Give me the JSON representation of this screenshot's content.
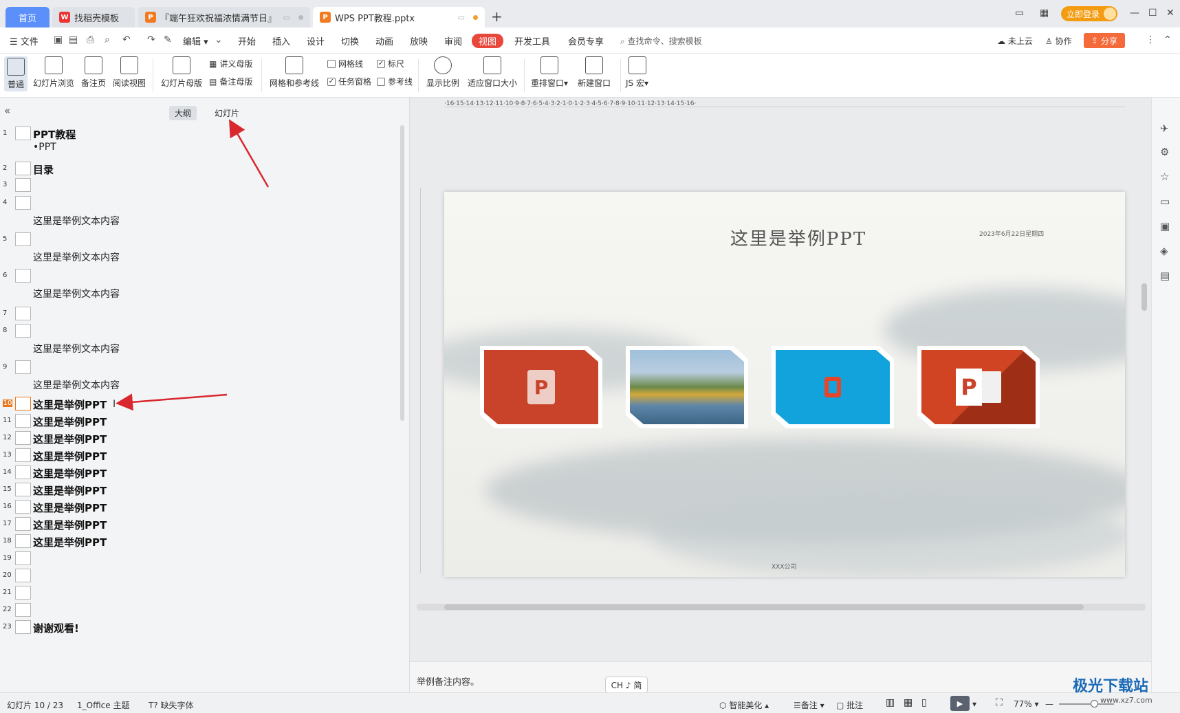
{
  "tabs": [
    {
      "label": "首页"
    },
    {
      "label": "找稻壳模板"
    },
    {
      "label": "『端午狂欢祝福浓情满节日』"
    },
    {
      "label": "WPS PPT教程.pptx"
    }
  ],
  "titlebar": {
    "login": "立即登录",
    "win_controls": [
      "—",
      "☐",
      "✕"
    ]
  },
  "menu": {
    "file": "文件",
    "edit": "编辑",
    "items": [
      "开始",
      "插入",
      "设计",
      "切换",
      "动画",
      "放映",
      "审阅",
      "视图",
      "开发工具",
      "会员专享"
    ],
    "search": "查找命令、搜索模板",
    "cloud": "未上云",
    "collab": "协作",
    "share": "分享"
  },
  "ribbon": {
    "normal": "普通",
    "sorter": "幻灯片浏览",
    "notes_page": "备注页",
    "reading": "阅读视图",
    "slide_master": "幻灯片母版",
    "handout_master": "讲义母版",
    "notes_master": "备注母版",
    "grid_guides": "网格和参考线",
    "gridlines": "网格线",
    "ruler": "标尺",
    "task_pane": "任务窗格",
    "guides": "参考线",
    "zoom": "显示比例",
    "fit_window": "适应窗口大小",
    "arrange": "重排窗口",
    "new_window": "新建窗口",
    "macro": "JS 宏"
  },
  "outline": {
    "tab_outline": "大纲",
    "tab_slides": "幻灯片",
    "rows": [
      {
        "n": "1",
        "title": "PPT教程",
        "sub": "•PPT"
      },
      {
        "n": "2",
        "title": "目录",
        "sub": ""
      },
      {
        "n": "3",
        "title": "",
        "sub": ""
      },
      {
        "n": "4",
        "title": "",
        "sub": "这里是举例文本内容"
      },
      {
        "n": "5",
        "title": "",
        "sub": "这里是举例文本内容"
      },
      {
        "n": "6",
        "title": "",
        "sub": "这里是举例文本内容"
      },
      {
        "n": "7",
        "title": "",
        "sub": ""
      },
      {
        "n": "8",
        "title": "",
        "sub": "这里是举例文本内容"
      },
      {
        "n": "9",
        "title": "",
        "sub": "这里是举例文本内容"
      },
      {
        "n": "10",
        "title": "这里是举例PPT",
        "sub": ""
      },
      {
        "n": "11",
        "title": "这里是举例PPT",
        "sub": ""
      },
      {
        "n": "12",
        "title": "这里是举例PPT",
        "sub": ""
      },
      {
        "n": "13",
        "title": "这里是举例PPT",
        "sub": ""
      },
      {
        "n": "14",
        "title": "这里是举例PPT",
        "sub": ""
      },
      {
        "n": "15",
        "title": "这里是举例PPT",
        "sub": ""
      },
      {
        "n": "16",
        "title": "这里是举例PPT",
        "sub": ""
      },
      {
        "n": "17",
        "title": "这里是举例PPT",
        "sub": ""
      },
      {
        "n": "18",
        "title": "这里是举例PPT",
        "sub": ""
      },
      {
        "n": "19",
        "title": "",
        "sub": ""
      },
      {
        "n": "20",
        "title": "",
        "sub": ""
      },
      {
        "n": "21",
        "title": "",
        "sub": ""
      },
      {
        "n": "22",
        "title": "",
        "sub": ""
      },
      {
        "n": "23",
        "title": "谢谢观看!",
        "sub": ""
      }
    ]
  },
  "ruler": "·16·15·14·13·12·11·10·9·8·7·6·5·4·3·2·1·0·1·2·3·4·5·6·7·8·9·10·11·12·13·14·15·16·",
  "slide": {
    "title": "这里是举例PPT",
    "date": "2023年6月22日星期四",
    "company": "XXX公司"
  },
  "notes": "举例备注内容。",
  "ime": "CH ♪ 简",
  "status": {
    "slide_info": "幻灯片 10 / 23",
    "theme": "1_Office 主题",
    "missing_font": "缺失字体",
    "beautify": "智能美化",
    "notes": "备注",
    "comments": "批注",
    "zoom": "77%"
  },
  "watermark": {
    "brand": "极光下载站",
    "url": "www.xz7.com"
  },
  "colors": {
    "accent": "#e8473c",
    "home_tab": "#5b8ff9",
    "current_slide": "#e8781f",
    "annotation_arrow": "#d9272e"
  }
}
